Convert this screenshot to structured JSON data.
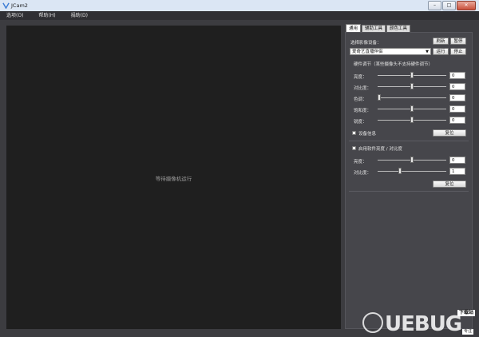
{
  "window": {
    "title": "JCam2",
    "minimize": "–",
    "maximize": "□",
    "close": "✕"
  },
  "menu": [
    {
      "label": "选项(O)"
    },
    {
      "label": "帮助(H)"
    },
    {
      "label": "捐助(D)"
    }
  ],
  "video": {
    "message": "等待摄像机运行"
  },
  "tabs": [
    {
      "label": "通用",
      "active": true
    },
    {
      "label": "辅助工具"
    },
    {
      "label": "颜色工具"
    }
  ],
  "device": {
    "label": "选择影像设备：",
    "refresh": "刷新",
    "pause": "暂停",
    "selected": "爱奇艺直播伴侣",
    "run": "运行",
    "stop": "停止"
  },
  "hardware": {
    "title": "硬件调节（某些摄像头不支持硬件调节）",
    "sliders": [
      {
        "label": "亮度：",
        "value": "0",
        "level": 0.5
      },
      {
        "label": "对比度：",
        "value": "0",
        "level": 0.5
      },
      {
        "label": "色调：",
        "value": "0",
        "level": 0.0
      },
      {
        "label": "饱和度：",
        "value": "0",
        "level": 0.5
      },
      {
        "label": "锐度：",
        "value": "0",
        "level": 0.5
      }
    ],
    "device_info": "设备信息",
    "reset": "复位"
  },
  "software": {
    "enable": "启用软件亮度 / 对比度",
    "sliders": [
      {
        "label": "亮度：",
        "value": "0",
        "level": 0.5
      },
      {
        "label": "对比度：",
        "value": "1",
        "level": 0.33
      }
    ],
    "reset": "复位"
  },
  "watermark": {
    "brand": "UEBUG",
    "tag_top": "下载站",
    "tag_bottom": "专注"
  },
  "colors": {
    "video_bg": "#1f1f1f",
    "panel_bg": "#46464b",
    "window_bg": "#3c3c40"
  }
}
